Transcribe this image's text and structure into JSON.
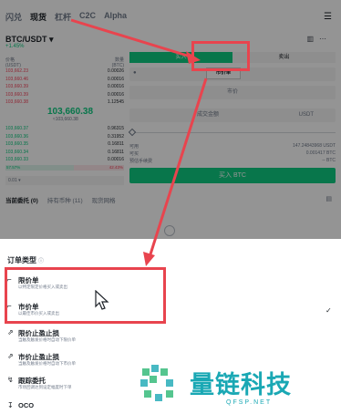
{
  "top_tabs": [
    "闪兑",
    "现货",
    "杠杆",
    "C2C",
    "Alpha"
  ],
  "active_tab_index": 1,
  "pair": {
    "symbol": "BTC/USDT",
    "change": "+1.45%"
  },
  "orderbook": {
    "head_left": "价格\n(USDT)",
    "head_right": "数量\n(BTC)",
    "asks": [
      {
        "price": "103,662.23",
        "qty": "0.00026"
      },
      {
        "price": "103,660.46",
        "qty": "0.00016"
      },
      {
        "price": "103,660.39",
        "qty": "0.00016"
      },
      {
        "price": "103,660.39",
        "qty": "0.00016"
      },
      {
        "price": "103,660.38",
        "qty": "1.12545"
      }
    ],
    "mid_price": "103,660.38",
    "mid_sub": "≈103,660.38",
    "bids": [
      {
        "price": "103,660.37",
        "qty": "0.96315"
      },
      {
        "price": "103,660.36",
        "qty": "0.31952"
      },
      {
        "price": "103,660.35",
        "qty": "0.16811"
      },
      {
        "price": "103,660.34",
        "qty": "0.16811"
      },
      {
        "price": "103,660.33",
        "qty": "0.00016"
      }
    ],
    "ratio_buy": "57.57%",
    "ratio_sell": "42.43%",
    "depth": "0.01"
  },
  "trade": {
    "buy_label": "买入",
    "sell_label": "卖出",
    "order_type": "市价单",
    "price_field": "市价",
    "amount_field": "成交金额",
    "amount_unit": "USDT",
    "available_label": "可用",
    "available_value": "147.24843968 USDT",
    "buyable_label": "可买",
    "buyable_value": "0.001417 BTC",
    "fee_label": "预估手续费",
    "fee_value": "-- BTC",
    "buy_button": "买入 BTC"
  },
  "bottom_tabs": [
    "当前委托 (0)",
    "持有币种 (11)",
    "现货网格"
  ],
  "sheet": {
    "title": "订单类型",
    "options": [
      {
        "title": "限价单",
        "desc": "以特定限定价格买入或卖出"
      },
      {
        "title": "市价单",
        "desc": "以最佳市价买入或卖出"
      },
      {
        "title": "限价止盈止损",
        "desc": "当触及触发价格时自动下限价单"
      },
      {
        "title": "市价止盈止损",
        "desc": "当触及触发价格时自动下市价单"
      },
      {
        "title": "跟踪委托",
        "desc": "市场回调达到设定幅度时下单"
      },
      {
        "title": "OCO",
        "desc": ""
      }
    ],
    "selected_index": 1
  },
  "watermark": {
    "name": "量链科技",
    "url": "QFSP.NET"
  }
}
